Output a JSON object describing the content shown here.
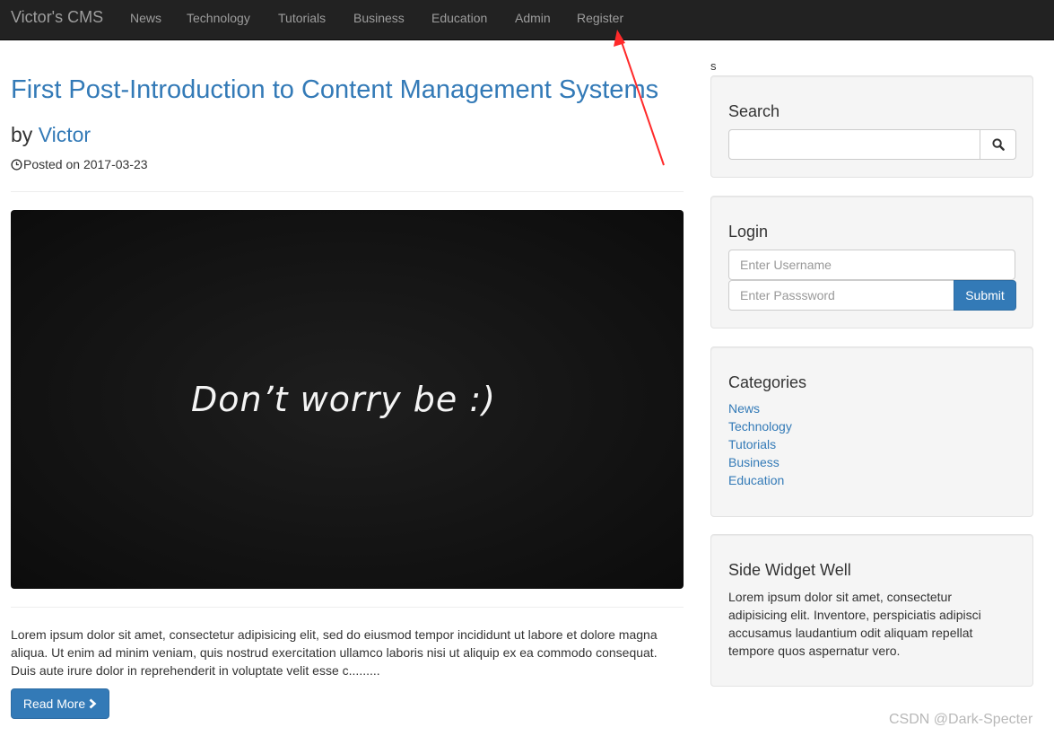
{
  "navbar": {
    "brand": "Victor's CMS",
    "items": [
      {
        "label": "News"
      },
      {
        "label": "Technology"
      },
      {
        "label": "Tutorials"
      },
      {
        "label": "Business"
      },
      {
        "label": "Education"
      },
      {
        "label": "Admin"
      },
      {
        "label": "Register"
      }
    ]
  },
  "post": {
    "title": "First Post-Introduction to Content Management Systems",
    "by_prefix": "by",
    "author": "Victor",
    "posted": "Posted on 2017-03-23",
    "image_text": "Don’t worry be :)",
    "excerpt": "Lorem ipsum dolor sit amet, consectetur adipisicing elit, sed do eiusmod tempor incididunt ut labore et dolore magna aliqua. Ut enim ad minim veniam, quis nostrud exercitation ullamco laboris nisi ut aliquip ex ea commodo consequat. Duis aute irure dolor in reprehenderit in voluptate velit esse c.........",
    "read_more": "Read More"
  },
  "sidebar": {
    "stray_text": "s",
    "search": {
      "title": "Search",
      "value": ""
    },
    "login": {
      "title": "Login",
      "username_placeholder": "Enter Username",
      "password_placeholder": "Enter Passsword",
      "submit": "Submit"
    },
    "categories": {
      "title": "Categories",
      "items": [
        "News",
        "Technology",
        "Tutorials",
        "Business",
        "Education"
      ]
    },
    "widget": {
      "title": "Side Widget Well",
      "text": "Lorem ipsum dolor sit amet, consectetur adipisicing elit. Inventore, perspiciatis adipisci accusamus laudantium odit aliquam repellat tempore quos aspernatur vero."
    }
  },
  "watermark": "CSDN @Dark-Specter",
  "colors": {
    "navbar": "#222222",
    "link": "#337ab7",
    "well": "#f5f5f5",
    "annotation_arrow": "#ff2a2a"
  }
}
